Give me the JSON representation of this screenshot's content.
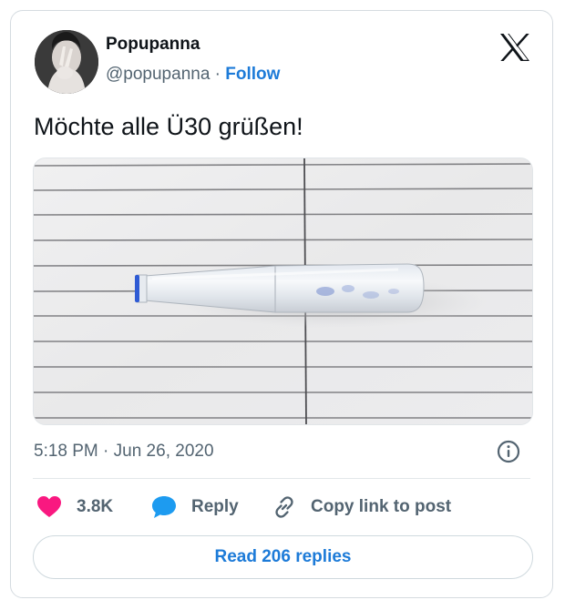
{
  "author": {
    "name": "Popupanna",
    "handle": "@popupanna",
    "separator": "·",
    "follow_label": "Follow",
    "avatar_icon": "user-avatar"
  },
  "brand": {
    "logo": "x-logo",
    "color": "#0f1419"
  },
  "tweet": {
    "text": "Möchte alle Ü30 grüßen!",
    "media": {
      "icon": "photo-pen-cartridge-on-lined-paper"
    },
    "timestamp": "5:18 PM · Jun 26, 2020"
  },
  "actions": {
    "like_count": "3.8K",
    "reply_label": "Reply",
    "copy_link_label": "Copy link to post",
    "read_replies_label": "Read 206 replies"
  },
  "colors": {
    "accent": "#1d7bd8",
    "like": "#f91880",
    "secondary_text": "#536471"
  }
}
